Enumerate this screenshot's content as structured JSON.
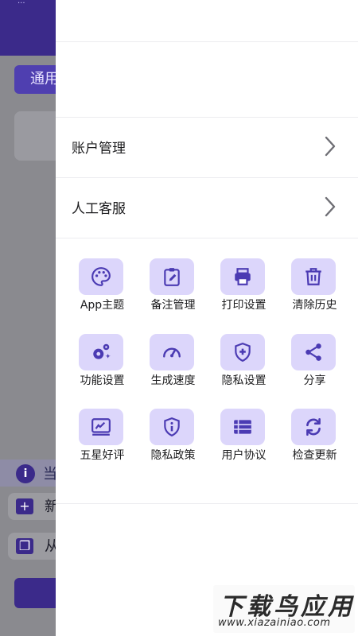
{
  "background_app": {
    "status_text": "...",
    "tab_label": "通用",
    "notice_text": "当",
    "row1_label": "新",
    "row2_label": "从",
    "header_color": "#3b2a8a"
  },
  "drawer": {
    "menu": [
      {
        "label": "账户管理",
        "icon": "chevron-right-icon"
      },
      {
        "label": "人工客服",
        "icon": "chevron-right-icon"
      }
    ],
    "grid": [
      {
        "label": "App主题",
        "icon": "palette-icon"
      },
      {
        "label": "备注管理",
        "icon": "clipboard-edit-icon"
      },
      {
        "label": "打印设置",
        "icon": "printer-icon"
      },
      {
        "label": "清除历史",
        "icon": "trash-icon"
      },
      {
        "label": "功能设置",
        "icon": "gears-icon"
      },
      {
        "label": "生成速度",
        "icon": "speedometer-icon"
      },
      {
        "label": "隐私设置",
        "icon": "shield-plus-icon"
      },
      {
        "label": "分享",
        "icon": "share-icon"
      },
      {
        "label": "五星好评",
        "icon": "review-icon"
      },
      {
        "label": "隐私政策",
        "icon": "shield-info-icon"
      },
      {
        "label": "用户协议",
        "icon": "list-icon"
      },
      {
        "label": "检查更新",
        "icon": "refresh-icon"
      }
    ],
    "icon_bg_color": "#dcd6fb",
    "icon_color": "#4b3bb3"
  },
  "watermark": {
    "title": "下载鸟应用",
    "url": "www.xiazainiao.com"
  }
}
